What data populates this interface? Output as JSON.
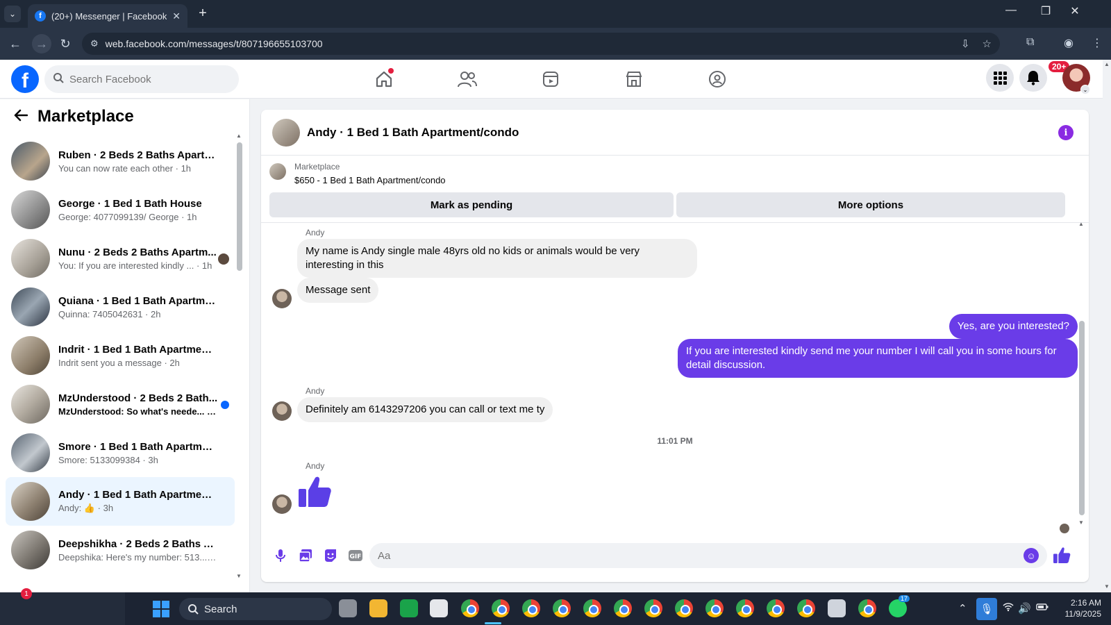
{
  "browser": {
    "tab_title": "(20+) Messenger | Facebook",
    "url": "web.facebook.com/messages/t/807196655103700"
  },
  "fb": {
    "search_placeholder": "Search Facebook",
    "notification_badge": "20+"
  },
  "sidebar": {
    "title": "Marketplace",
    "conversations": [
      {
        "name": "Ruben · 2 Beds 2 Baths Apartme...",
        "preview": "You can now rate each other · 1h",
        "unread": false,
        "active": false
      },
      {
        "name": "George · 1 Bed 1 Bath House",
        "preview": "George: 4077099139/ George · 1h",
        "unread": false,
        "active": false
      },
      {
        "name": "Nunu · 2 Beds 2 Baths Apartm...",
        "preview": "You: If you are interested kindly ... · 1h",
        "unread": false,
        "active": false
      },
      {
        "name": "Quiana · 1 Bed 1 Bath Apartment...",
        "preview": "Quinna: 7405042631 · 2h",
        "unread": false,
        "active": false
      },
      {
        "name": "Indrit · 1 Bed 1 Bath Apartment/...",
        "preview": "Indrit sent you a message · 2h",
        "unread": false,
        "active": false
      },
      {
        "name": "MzUnderstood · 2 Beds 2 Bath...",
        "preview": "MzUnderstood: So what's neede... · 3h",
        "unread": true,
        "active": false
      },
      {
        "name": "Smore · 1 Bed 1 Bath Apartment...",
        "preview": "Smore: 5133099384 · 3h",
        "unread": false,
        "active": false
      },
      {
        "name": "Andy · 1 Bed 1 Bath Apartment/c...",
        "preview": "Andy: 👍 · 3h",
        "unread": false,
        "active": true
      },
      {
        "name": "Deepshikha · 2 Beds 2 Baths Ap...",
        "preview": "Deepshika: Here's my number: 513... · 4h",
        "unread": false,
        "active": false
      }
    ]
  },
  "chat": {
    "title": "Andy · 1 Bed 1 Bath Apartment/condo",
    "listing_source": "Marketplace",
    "listing_name": "$650 - 1 Bed 1 Bath Apartment/condo",
    "mark_pending_label": "Mark as pending",
    "more_options_label": "More options",
    "messages": {
      "sender_1": "Andy",
      "in_1": "My name is Andy single male 48yrs old no kids or animals would be very interesting in this",
      "in_2": "Message sent",
      "out_1": "Yes, are you interested?",
      "out_2": "If you are interested kindly send me your number I will call you in some hours for detail discussion.",
      "sender_2": "Andy",
      "in_3": "Definitely am 6143297206 you can call or text me ty",
      "timestamp": "11:01 PM",
      "sender_3": "Andy"
    },
    "composer_placeholder": "Aa",
    "accent_color": "#6a3ce8"
  },
  "taskbar": {
    "search_label": "Search",
    "whatsapp_badge": "17",
    "time": "2:16 AM",
    "date": "11/9/2025",
    "notif_count": "1"
  }
}
